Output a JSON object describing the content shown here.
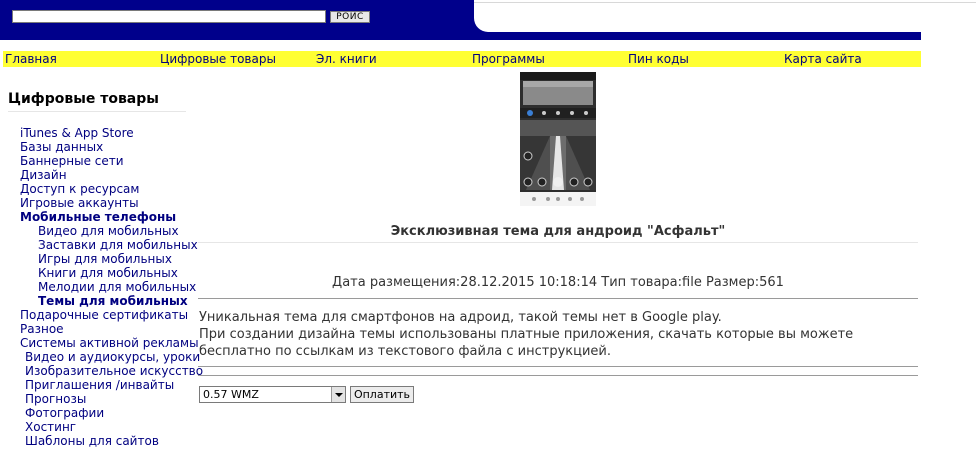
{
  "header": {
    "search_value": "",
    "search_button_label": "POИC"
  },
  "nav": {
    "items": [
      "Главная",
      "Цифровые товары",
      "Эл. книги",
      "Программы",
      "Пин коды",
      "Карта сайта"
    ]
  },
  "sidebar": {
    "title": "Цифровые товары",
    "items": [
      {
        "label": "iTunes & App Store"
      },
      {
        "label": "Базы данных"
      },
      {
        "label": "Баннерные сети"
      },
      {
        "label": "Дизайн"
      },
      {
        "label": "Доступ к ресурсам"
      },
      {
        "label": "Игровые аккаунты"
      },
      {
        "label": "Мобильные телефоны"
      },
      {
        "label": "Видео для мобильных"
      },
      {
        "label": "Заставки для мобильных"
      },
      {
        "label": "Игры для мобильных"
      },
      {
        "label": "Книги для мобильных"
      },
      {
        "label": "Мелодии для мобильных"
      },
      {
        "label": "Темы для мобильных"
      },
      {
        "label": "Подарочные сертификаты"
      },
      {
        "label": "Разное"
      },
      {
        "label": "Системы активной рекламы"
      },
      {
        "label": "Видео и аудиокурсы, уроки"
      },
      {
        "label": "Изобразительное искусство"
      },
      {
        "label": "Приглашения /инвайты"
      },
      {
        "label": "Прогнозы"
      },
      {
        "label": "Фотографии"
      },
      {
        "label": "Хостинг"
      },
      {
        "label": "Шаблоны для сайтов"
      }
    ]
  },
  "product": {
    "title": "Эксклюзивная тема для андроид \"Асфальт\"",
    "meta": "Дата размещения:28.12.2015 10:18:14   Тип товара:file   Размер:561",
    "description_1": "Уникальная тема для смартфонов на адроид, такой темы нет в Google play.",
    "description_2": "При создании дизайна темы использованы платные приложения, скачать которые вы можете бесплатно по ссылкам из текстового файла с инструкцией."
  },
  "purchase": {
    "price_option": "0.57 WMZ",
    "pay_button_label": "Оплатить"
  },
  "colors": {
    "header_blue": "#00008b",
    "nav_yellow": "#ffff33",
    "link_blue": "#000080"
  }
}
